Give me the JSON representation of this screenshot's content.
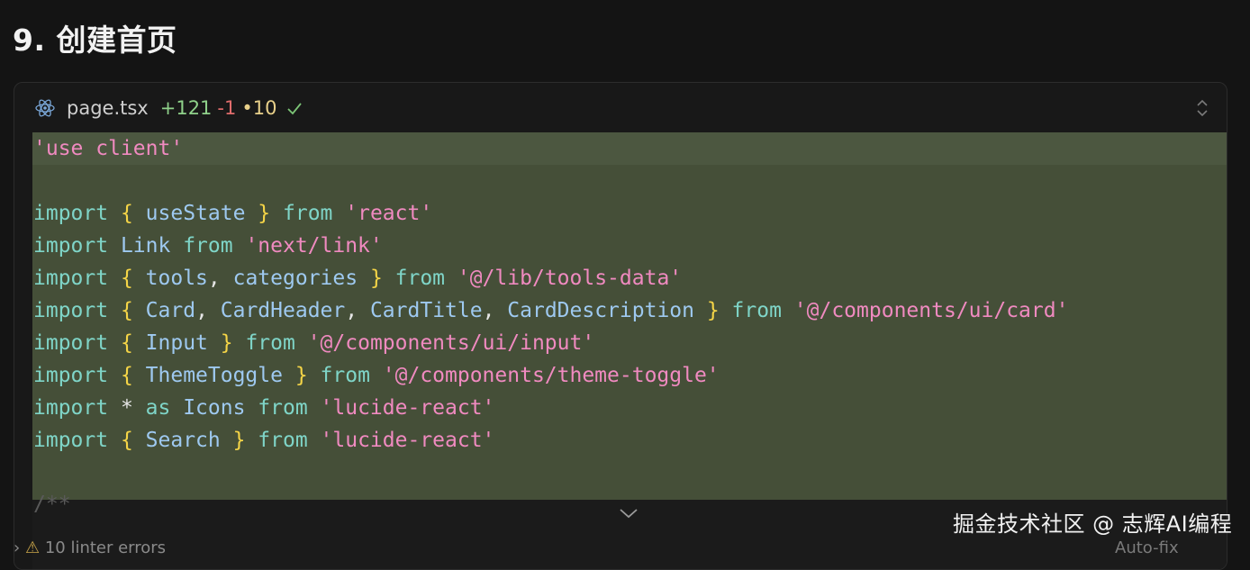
{
  "heading": "9. 创建首页",
  "file": {
    "name": "page.tsx",
    "added": "+121",
    "removed": "-1",
    "modified": "•10",
    "status_icon": "checkmark-icon",
    "file_icon": "react-icon"
  },
  "code_lines": [
    [
      {
        "t": "'use client'",
        "c": "str"
      }
    ],
    [],
    [
      {
        "t": "import",
        "c": "kw"
      },
      {
        "t": " ",
        "c": "p"
      },
      {
        "t": "{",
        "c": "br"
      },
      {
        "t": " useState ",
        "c": "id"
      },
      {
        "t": "}",
        "c": "br"
      },
      {
        "t": " from ",
        "c": "kw"
      },
      {
        "t": "'react'",
        "c": "str"
      }
    ],
    [
      {
        "t": "import",
        "c": "kw"
      },
      {
        "t": " Link ",
        "c": "id"
      },
      {
        "t": "from",
        "c": "kw"
      },
      {
        "t": " ",
        "c": "p"
      },
      {
        "t": "'next/link'",
        "c": "str"
      }
    ],
    [
      {
        "t": "import",
        "c": "kw"
      },
      {
        "t": " ",
        "c": "p"
      },
      {
        "t": "{",
        "c": "br"
      },
      {
        "t": " tools",
        "c": "id"
      },
      {
        "t": ", ",
        "c": "p"
      },
      {
        "t": "categories ",
        "c": "id"
      },
      {
        "t": "}",
        "c": "br"
      },
      {
        "t": " from ",
        "c": "kw"
      },
      {
        "t": "'@/lib/tools-data'",
        "c": "str"
      }
    ],
    [
      {
        "t": "import",
        "c": "kw"
      },
      {
        "t": " ",
        "c": "p"
      },
      {
        "t": "{",
        "c": "br"
      },
      {
        "t": " Card",
        "c": "id"
      },
      {
        "t": ", ",
        "c": "p"
      },
      {
        "t": "CardHeader",
        "c": "id"
      },
      {
        "t": ", ",
        "c": "p"
      },
      {
        "t": "CardTitle",
        "c": "id"
      },
      {
        "t": ", ",
        "c": "p"
      },
      {
        "t": "CardDescription ",
        "c": "id"
      },
      {
        "t": "}",
        "c": "br"
      },
      {
        "t": " from ",
        "c": "kw"
      },
      {
        "t": "'@/components/ui/card'",
        "c": "str"
      }
    ],
    [
      {
        "t": "import",
        "c": "kw"
      },
      {
        "t": " ",
        "c": "p"
      },
      {
        "t": "{",
        "c": "br"
      },
      {
        "t": " Input ",
        "c": "id"
      },
      {
        "t": "}",
        "c": "br"
      },
      {
        "t": " from ",
        "c": "kw"
      },
      {
        "t": "'@/components/ui/input'",
        "c": "str"
      }
    ],
    [
      {
        "t": "import",
        "c": "kw"
      },
      {
        "t": " ",
        "c": "p"
      },
      {
        "t": "{",
        "c": "br"
      },
      {
        "t": " ThemeToggle ",
        "c": "id"
      },
      {
        "t": "}",
        "c": "br"
      },
      {
        "t": " from ",
        "c": "kw"
      },
      {
        "t": "'@/components/theme-toggle'",
        "c": "str"
      }
    ],
    [
      {
        "t": "import",
        "c": "kw"
      },
      {
        "t": " * ",
        "c": "p"
      },
      {
        "t": "as",
        "c": "kw"
      },
      {
        "t": " Icons ",
        "c": "id"
      },
      {
        "t": "from",
        "c": "kw"
      },
      {
        "t": " ",
        "c": "p"
      },
      {
        "t": "'lucide-react'",
        "c": "str"
      }
    ],
    [
      {
        "t": "import",
        "c": "kw"
      },
      {
        "t": " ",
        "c": "p"
      },
      {
        "t": "{",
        "c": "br"
      },
      {
        "t": " Search ",
        "c": "id"
      },
      {
        "t": "}",
        "c": "br"
      },
      {
        "t": " from ",
        "c": "kw"
      },
      {
        "t": "'lucide-react'",
        "c": "str"
      }
    ],
    []
  ],
  "collapsed_comment": "/**",
  "expand_icon": "chevron-down-icon",
  "collapse_toggle_icon": "chevron-up-down-icon",
  "linter": {
    "text": "10 linter errors",
    "icon": "warning-icon"
  },
  "autofix_label": "Auto-fix",
  "watermark": "掘金技术社区 @ 志辉AI编程",
  "colors": {
    "background": "#141414",
    "diff_added_bg": "#454f38",
    "keyword": "#7fd5c8",
    "brace": "#f5d547",
    "identifier": "#9ec9f0",
    "string": "#f08ac0"
  }
}
